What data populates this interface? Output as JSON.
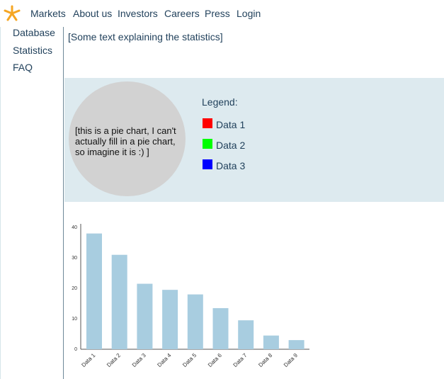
{
  "nav": {
    "items": [
      {
        "label": "Markets",
        "name": "nav-markets"
      },
      {
        "label": "About us",
        "name": "nav-about-us"
      },
      {
        "label": "Investors",
        "name": "nav-investors"
      },
      {
        "label": "Careers",
        "name": "nav-careers"
      },
      {
        "label": "Press",
        "name": "nav-press"
      },
      {
        "label": "Login",
        "name": "nav-login"
      }
    ]
  },
  "sidebar": {
    "items": [
      {
        "label": "Database"
      },
      {
        "label": "Statistics"
      },
      {
        "label": "FAQ"
      }
    ]
  },
  "main": {
    "intro_text": "[Some text explaining the statistics]"
  },
  "pie": {
    "placeholder_text": "[this is a pie chart, I can't actually fill in a pie chart, so imagine it is :) ]",
    "legend_title": "Legend:",
    "legend": [
      {
        "label": "Data 1",
        "color": "#ff0000"
      },
      {
        "label": "Data 2",
        "color": "#00ff00"
      },
      {
        "label": "Data 3",
        "color": "#0000ff"
      }
    ]
  },
  "colors": {
    "accent": "#f5a623",
    "text": "#1f3f5a",
    "panel": "#ddeaef",
    "bar": "#a8cde0",
    "pie_placeholder": "#d2d2d2"
  },
  "chart_data": {
    "type": "bar",
    "categories": [
      "Data 1",
      "Data 2",
      "Data 3",
      "Data 4",
      "Data 5",
      "Data 6",
      "Data 7",
      "Data 8",
      "Data 9"
    ],
    "values": [
      38,
      31,
      21.5,
      19.5,
      18,
      13.5,
      9.5,
      4.5,
      3
    ],
    "title": "",
    "xlabel": "",
    "ylabel": "",
    "ylim": [
      0,
      40
    ],
    "yticks": [
      0,
      10,
      20,
      30,
      40
    ],
    "grid": false,
    "color": "#a8cde0"
  }
}
